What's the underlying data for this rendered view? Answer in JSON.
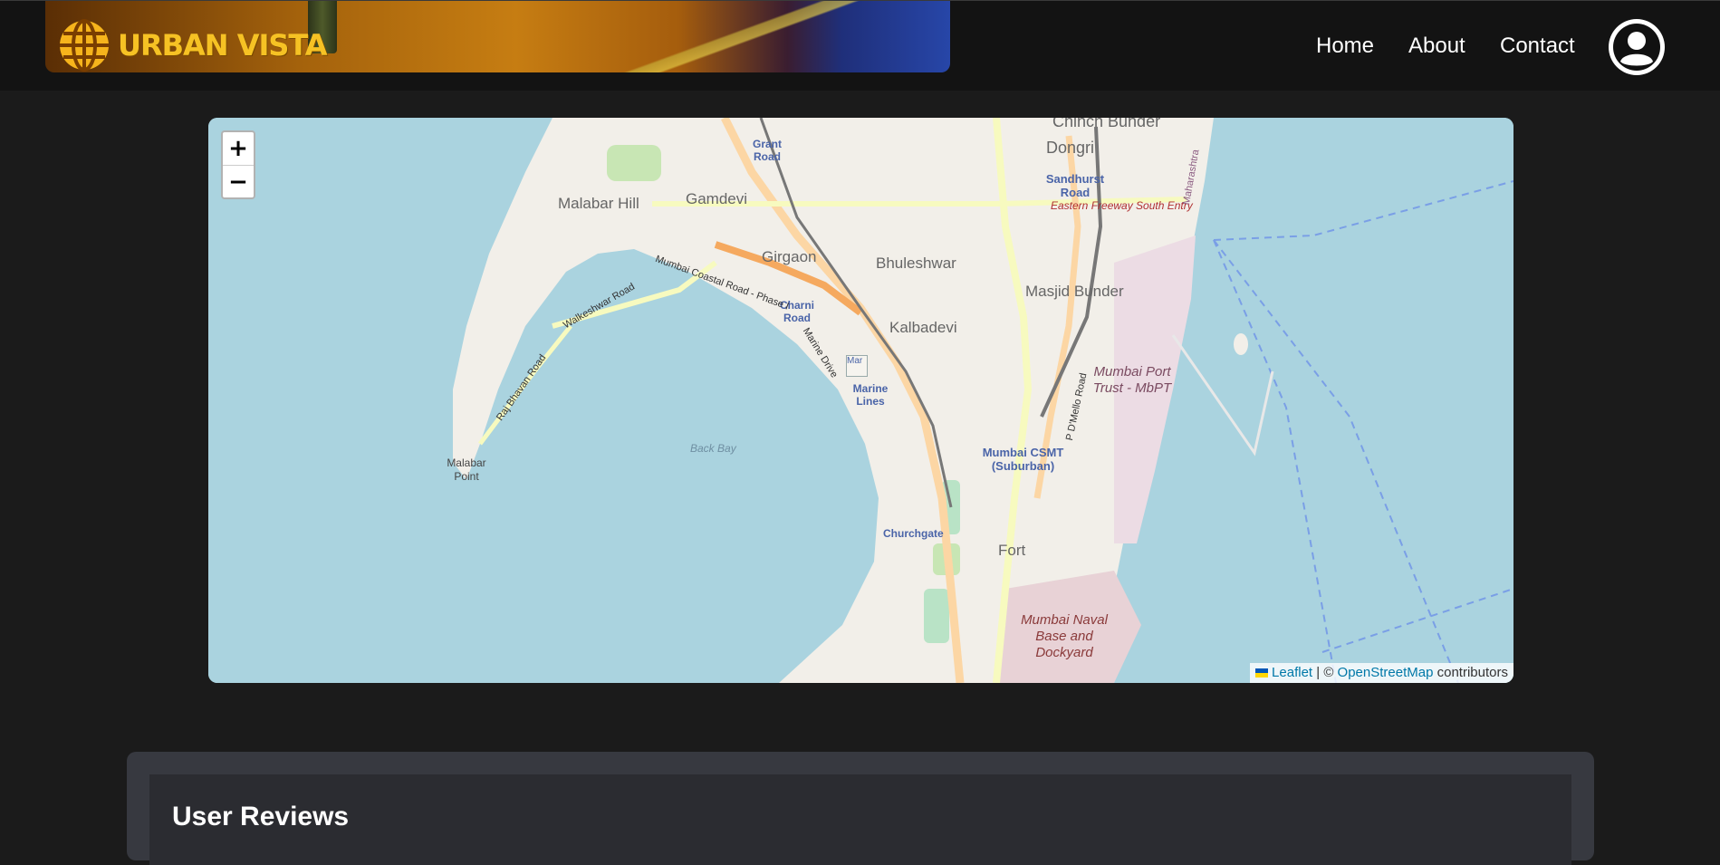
{
  "header": {
    "logo_text": "URBAN VISTA",
    "nav": [
      "Home",
      "About",
      "Contact"
    ]
  },
  "map": {
    "zoom_in": "+",
    "zoom_out": "−",
    "labels": {
      "chinch_bunder": "Chinch Bunder",
      "grant_road": "Grant Road",
      "dongri": "Dongri",
      "sandhurst_road": "Sandhurst Road",
      "eastern_freeway": "Eastern Freeway South Entry",
      "malabar_hill": "Malabar Hill",
      "gamdevi": "Gamdevi",
      "girgaon": "Girgaon",
      "bhuleshwar": "Bhuleshwar",
      "masjid_bunder": "Masjid Bunder",
      "kalbadevi": "Kalbadevi",
      "charni_road": "Charni Road",
      "marine_lines": "Marine Lines",
      "mumbai_port_trust": "Mumbai Port Trust - MbPT",
      "malabar_point": "Malabar Point",
      "back_bay": "Back Bay",
      "mumbai_csmt": "Mumbai CSMT (Suburban)",
      "churchgate": "Churchgate",
      "fort": "Fort",
      "naval_base": "Mumbai Naval Base and Dockyard",
      "coastal_road": "Mumbai Coastal Road - Phase I",
      "walkeshwar_road": "Walkeshwar Road",
      "raj_bhavan_road": "Raj Bhavan Road",
      "marine_drive": "Marine Drive",
      "p_d_mello_road": "P D'Mello Road",
      "maharashtra": "Maharashtra",
      "marker_alt": "Mar"
    },
    "attribution": {
      "leaflet": "Leaflet",
      "separator": " | © ",
      "osm": "OpenStreetMap",
      "contributors": " contributors"
    }
  },
  "reviews": {
    "title": "User Reviews"
  },
  "colors": {
    "water": "#aad3df",
    "land": "#f2efe9",
    "accent": "#f6c224"
  }
}
